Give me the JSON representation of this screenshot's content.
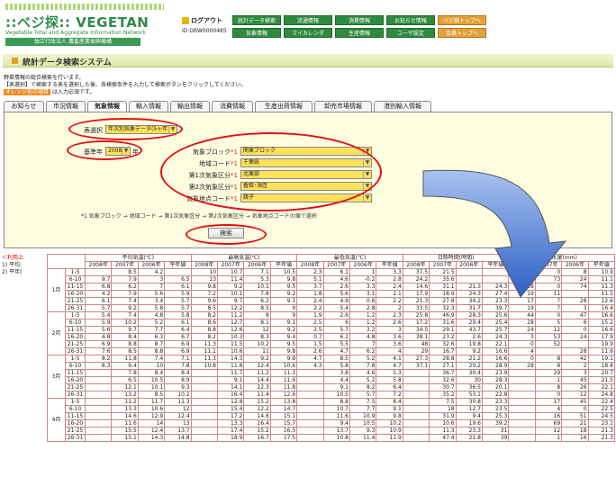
{
  "header": {
    "logo": "::ベジ探:: VEGETAN",
    "subtitle": "Vegetable Total and Aggregate Information Network",
    "org": "独立行政法人 農畜産業振興機構",
    "logout": "ログアウト",
    "user_id": "ID:GRW0000485"
  },
  "nav": [
    "統計データ検索",
    "流通情報",
    "消費情報",
    "お知らせ情報",
    "ベジ探トップへ",
    "気象情報",
    "マイカレンダ",
    "生産情報",
    "ユーザ設定",
    "会員トップへ"
  ],
  "page_title": "統計データ検索システム",
  "desc": {
    "line1": "野菜情報の総合検索を行います。",
    "line2": "【表選択】で検索する表を選択した後、各検索条件を入力して検索ボタンをクリックしてください。",
    "req_tag": "オレンジ色の項目",
    "req_text": " は入力必須です。"
  },
  "tabs": [
    "お知らせ",
    "市況情報",
    "気象情報",
    "輸入情報",
    "輸出情報",
    "消費情報",
    "生産出荷情報",
    "卸売市場情報",
    "港別輸入情報"
  ],
  "form": {
    "table_label": "表選択",
    "table_value": "年次別気象データ(5ヶ年)",
    "year_label": "基準年",
    "year_value": "2008",
    "year_unit": "年",
    "block_label": "気象ブロック",
    "block_value": "関東ブロック",
    "pref_label": "地域コード",
    "pref_value": "千葉県",
    "area1_label": "第1次気象区分",
    "area1_value": "北東部",
    "area2_label": "第2次気象区分",
    "area2_value": "香取･海匝",
    "point_label": "気象地点コード",
    "point_value": "銚子",
    "required_mark": "*1",
    "note": "*1 気象ブロック → 地域コード → 第1次気象区分 → 第2次気象区分 → 気象地点コードの順で選択",
    "search_button": "検索"
  },
  "legend": {
    "line1": "＜利用上",
    "line2": "1) 平均:",
    "line3": "2) 平年("
  },
  "table": {
    "groups": [
      "平均気温(℃)",
      "最高気温(℃)",
      "最低気温(℃)",
      "日照時間(時間)",
      "降水量(mm)"
    ],
    "subcols": [
      "2008年",
      "2007年",
      "2006年",
      "平年値"
    ],
    "months": [
      "1月",
      "2月",
      "3月",
      "4月"
    ],
    "rows": [
      [
        "1月",
        "1-5",
        [
          "",
          "8.5",
          "4.2",
          "",
          "10",
          "10.7",
          "7.1",
          "10.5",
          "2.3",
          "6.1",
          "1",
          "3.3",
          "37.5",
          "21.5",
          "",
          "",
          "2",
          "0",
          "8",
          "10.9"
        ]
      ],
      [
        "",
        "6-10",
        [
          "9.7",
          "7.9",
          "3",
          "6.5",
          "13",
          "11.4",
          "5.3",
          "9.8",
          "5.1",
          "4.6",
          "-0.2",
          "2.8",
          "24.2",
          "35.6",
          "",
          "",
          "0",
          "73",
          "24",
          "11.1"
        ]
      ],
      [
        "",
        "11-15",
        [
          "6.8",
          "6.2",
          "7",
          "6.1",
          "9.8",
          "9.2",
          "10.1",
          "9.5",
          "3.7",
          "2.6",
          "3.3",
          "2.4",
          "14.6",
          "31.1",
          "21.3",
          "24.3",
          "18",
          "0",
          "74",
          "11.3"
        ]
      ],
      [
        "",
        "16-20",
        [
          "4.2",
          "7.9",
          "5.6",
          "5.9",
          "7.2",
          "10.1",
          "7.8",
          "9.2",
          "1.8",
          "5.6",
          "3.1",
          "2.1",
          "17.9",
          "18.9",
          "24.3",
          "27.4",
          "19",
          "11",
          "",
          "11.5"
        ]
      ],
      [
        "",
        "21-25",
        [
          "6.1",
          "7.4",
          "3.4",
          "5.7",
          "9.6",
          "9.7",
          "6.2",
          "9.1",
          "2.4",
          "4.9",
          "0.6",
          "2.2",
          "21.3",
          "27.8",
          "34.2",
          "23.3",
          "17",
          "7",
          "28",
          "12.6"
        ]
      ],
      [
        "",
        "26-31",
        [
          "5.7",
          "9.2",
          "5.8",
          "5.7",
          "8.5",
          "12.2",
          "8.5",
          "9",
          "2.2",
          "5.4",
          "2.8",
          "2",
          "33.5",
          "32.3",
          "31.7",
          "39.7",
          "19",
          "7",
          "3",
          "16.4"
        ]
      ],
      [
        "2月",
        "1-5",
        [
          "5.4",
          "7.4",
          "4.8",
          "5.8",
          "8.2",
          "11.2",
          "8",
          "9",
          "1.9",
          "2.6",
          "1.2",
          "2.3",
          "25.8",
          "46.9",
          "28.3",
          "25.6",
          "44",
          "0",
          "47",
          "16.6"
        ]
      ],
      [
        "",
        "6-10",
        [
          "5.9",
          "10.2",
          "5.2",
          "6.1",
          "8.6",
          "12.7",
          "8.1",
          "9.1",
          "2.5",
          "6",
          "1.2",
          "2.6",
          "17.2",
          "31.6",
          "29.4",
          "25.4",
          "28",
          "5",
          "6",
          "15.2"
        ]
      ],
      [
        "",
        "11-15",
        [
          "5.6",
          "9.7",
          "7.7",
          "6.4",
          "8.8",
          "12.6",
          "12",
          "9.2",
          "2.5",
          "5.7",
          "3.2",
          "3",
          "34.5",
          "29.1",
          "43.7",
          "25.7",
          "24",
          "12",
          "0",
          "16.6"
        ]
      ],
      [
        "",
        "16-20",
        [
          "4.8",
          "8.4",
          "6.3",
          "6.7",
          "8.2",
          "10.3",
          "8.3",
          "9.4",
          "0.7",
          "6.1",
          "4.8",
          "3.6",
          "38.1",
          "23.2",
          "2.6",
          "24.3",
          "3",
          "53",
          "24",
          "17.9"
        ]
      ],
      [
        "",
        "21-25",
        [
          "6.9",
          "8.8",
          "8.7",
          "6.9",
          "11.3",
          "11.5",
          "10.2",
          "9.5",
          "1.5",
          "5.5",
          "7",
          "3.6",
          "48",
          "32.6",
          "19.8",
          "22.1",
          "0",
          "52",
          "",
          "19.9"
        ]
      ],
      [
        "",
        "26-31",
        [
          "7.6",
          "8.5",
          "8.8",
          "6.9",
          "11.1",
          "10.6",
          "11",
          "9.8",
          "2.6",
          "4.7",
          "6.2",
          "4",
          "29",
          "16.7",
          "9.2",
          "16.6",
          "4",
          "",
          "28",
          "11.6"
        ]
      ],
      [
        "3月",
        "1-5",
        [
          "8.2",
          "11.8",
          "7.4",
          "7.1",
          "11.3",
          "14.3",
          "9.2",
          "9.8",
          "4.7",
          "8.5",
          "5.2",
          "4.1",
          "27.3",
          "28.8",
          "21.2",
          "16.6",
          "0",
          "8",
          "42",
          "19.1"
        ]
      ],
      [
        "",
        "6-10",
        [
          "8.3",
          "9.4",
          "10",
          "7.8",
          "10.8",
          "11.8",
          "12.4",
          "10.6",
          "4.3",
          "5.8",
          "7.8",
          "4.7",
          "37.1",
          "27.1",
          "20.2",
          "28.9",
          "28",
          "8",
          "2",
          "18.8"
        ]
      ],
      [
        "",
        "11-15",
        [
          "",
          "7.8",
          "8.4",
          "8.4",
          "",
          "11.7",
          "11.2",
          "11.1",
          "",
          "3.8",
          "4.6",
          "5.3",
          "",
          "36.7",
          "30.4",
          "23.9",
          "",
          "29",
          "3",
          "20.7"
        ]
      ],
      [
        "",
        "16-20",
        [
          "",
          "6.5",
          "10.5",
          "8.9",
          "",
          "9.1",
          "14.4",
          "11.6",
          "",
          "4.4",
          "5.2",
          "5.8",
          "",
          "32.6",
          "30",
          "28.3",
          "",
          "1",
          "45",
          "21.5"
        ]
      ],
      [
        "",
        "21-25",
        [
          "",
          "12.1",
          "10.1",
          "9.3",
          "",
          "14.1",
          "12.3",
          "11.8",
          "",
          "9.1",
          "8.2",
          "6.4",
          "",
          "30.7",
          "36.5",
          "20.1",
          "",
          "8",
          "26",
          "22.1"
        ]
      ],
      [
        "",
        "26-31",
        [
          "",
          "13.2",
          "8.5",
          "10.2",
          "",
          "16.4",
          "11.4",
          "12.6",
          "",
          "10.5",
          "5.7",
          "7.2",
          "",
          "35.2",
          "53.1",
          "22.8",
          "",
          "0",
          "12",
          "24.8"
        ]
      ],
      [
        "4月",
        "1-5",
        [
          "",
          "11.2",
          "11.7",
          "11.3",
          "",
          "12.8",
          "15.2",
          "13.8",
          "",
          "8.8",
          "7.5",
          "8.4",
          "",
          "7.5",
          "30.8",
          "23.3",
          "",
          "17",
          "45",
          "22.4"
        ]
      ],
      [
        "",
        "6-10",
        [
          "",
          "13.3",
          "10.6",
          "12",
          "",
          "15.4",
          "12.2",
          "14.7",
          "",
          "10.7",
          "7.7",
          "9.1",
          "",
          "18",
          "12.7",
          "23.5",
          "",
          "4",
          "0",
          "22.5"
        ]
      ],
      [
        "",
        "11-15",
        [
          "",
          "14.6",
          "12.9",
          "12.4",
          "",
          "17.2",
          "14.6",
          "15.1",
          "",
          "11.6",
          "10.9",
          "9.8",
          "",
          "31.9",
          "9.4",
          "25.3",
          "",
          "16",
          "51",
          "24.5"
        ]
      ],
      [
        "",
        "16-20",
        [
          "",
          "11.6",
          "14",
          "13",
          "",
          "13.3",
          "16.4",
          "15.7",
          "",
          "9.4",
          "10.5",
          "10.2",
          "",
          "10.6",
          "19.6",
          "39.2",
          "",
          "69",
          "21",
          "23.1"
        ]
      ],
      [
        "",
        "21-25",
        [
          "",
          "15.5",
          "12.4",
          "13.7",
          "",
          "17.4",
          "15.2",
          "16.5",
          "",
          "13.7",
          "9.3",
          "10.9",
          "",
          "11.3",
          "23.3",
          "31",
          "",
          "12",
          "18",
          "21.3"
        ]
      ],
      [
        "",
        "26-31",
        [
          "",
          "15.1",
          "14.3",
          "14.8",
          "",
          "18.9",
          "16.7",
          "17.5",
          "",
          "10.8",
          "11.4",
          "11.9",
          "",
          "47.4",
          "21.8",
          "39",
          "",
          "1",
          "16",
          "21.3"
        ]
      ]
    ]
  }
}
